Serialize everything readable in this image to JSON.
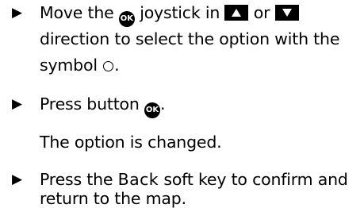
{
  "steps": [
    {
      "lines": [
        {
          "a": "Move the",
          "b": "joystick in",
          "c": "or"
        },
        {
          "text": "direction to select the option with the"
        },
        {
          "a": "symbol",
          "b": "."
        }
      ]
    },
    {
      "lines": [
        {
          "a": "Press button",
          "b": "."
        }
      ]
    },
    {
      "lines": [
        {
          "a": "Press the",
          "softkey": "Back",
          "b": "soft key to confirm and"
        },
        {
          "text": "return to the map."
        }
      ]
    }
  ],
  "result_text": "The option is changed.",
  "icons": {
    "bullet": "▶",
    "ok_button_label": "OK",
    "up_arrow": "up-arrow-key-icon",
    "down_arrow": "down-arrow-key-icon",
    "circle": "circle-symbol-icon"
  }
}
